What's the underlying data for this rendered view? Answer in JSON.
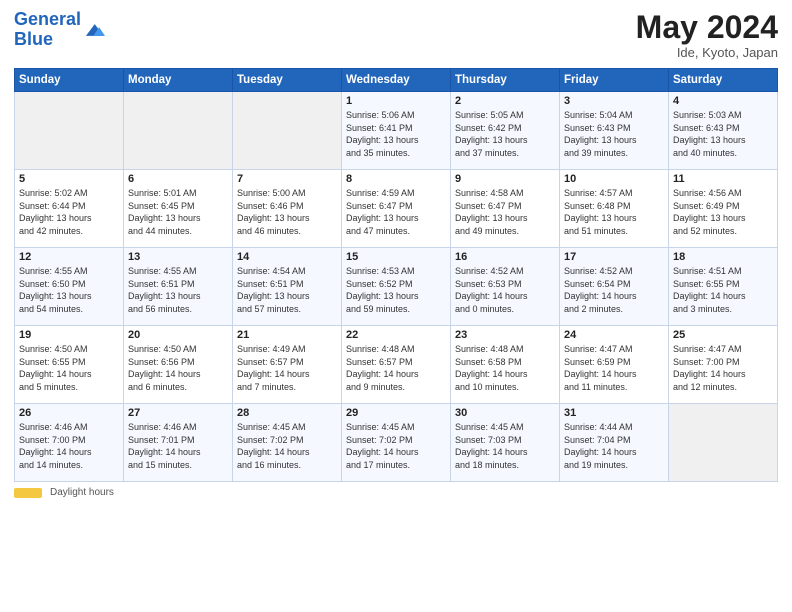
{
  "header": {
    "logo_line1": "General",
    "logo_line2": "Blue",
    "month": "May 2024",
    "location": "Ide, Kyoto, Japan"
  },
  "days_of_week": [
    "Sunday",
    "Monday",
    "Tuesday",
    "Wednesday",
    "Thursday",
    "Friday",
    "Saturday"
  ],
  "footer": {
    "daylight_label": "Daylight hours"
  },
  "weeks": [
    [
      {
        "day": "",
        "info": ""
      },
      {
        "day": "",
        "info": ""
      },
      {
        "day": "",
        "info": ""
      },
      {
        "day": "1",
        "info": "Sunrise: 5:06 AM\nSunset: 6:41 PM\nDaylight: 13 hours\nand 35 minutes."
      },
      {
        "day": "2",
        "info": "Sunrise: 5:05 AM\nSunset: 6:42 PM\nDaylight: 13 hours\nand 37 minutes."
      },
      {
        "day": "3",
        "info": "Sunrise: 5:04 AM\nSunset: 6:43 PM\nDaylight: 13 hours\nand 39 minutes."
      },
      {
        "day": "4",
        "info": "Sunrise: 5:03 AM\nSunset: 6:43 PM\nDaylight: 13 hours\nand 40 minutes."
      }
    ],
    [
      {
        "day": "5",
        "info": "Sunrise: 5:02 AM\nSunset: 6:44 PM\nDaylight: 13 hours\nand 42 minutes."
      },
      {
        "day": "6",
        "info": "Sunrise: 5:01 AM\nSunset: 6:45 PM\nDaylight: 13 hours\nand 44 minutes."
      },
      {
        "day": "7",
        "info": "Sunrise: 5:00 AM\nSunset: 6:46 PM\nDaylight: 13 hours\nand 46 minutes."
      },
      {
        "day": "8",
        "info": "Sunrise: 4:59 AM\nSunset: 6:47 PM\nDaylight: 13 hours\nand 47 minutes."
      },
      {
        "day": "9",
        "info": "Sunrise: 4:58 AM\nSunset: 6:47 PM\nDaylight: 13 hours\nand 49 minutes."
      },
      {
        "day": "10",
        "info": "Sunrise: 4:57 AM\nSunset: 6:48 PM\nDaylight: 13 hours\nand 51 minutes."
      },
      {
        "day": "11",
        "info": "Sunrise: 4:56 AM\nSunset: 6:49 PM\nDaylight: 13 hours\nand 52 minutes."
      }
    ],
    [
      {
        "day": "12",
        "info": "Sunrise: 4:55 AM\nSunset: 6:50 PM\nDaylight: 13 hours\nand 54 minutes."
      },
      {
        "day": "13",
        "info": "Sunrise: 4:55 AM\nSunset: 6:51 PM\nDaylight: 13 hours\nand 56 minutes."
      },
      {
        "day": "14",
        "info": "Sunrise: 4:54 AM\nSunset: 6:51 PM\nDaylight: 13 hours\nand 57 minutes."
      },
      {
        "day": "15",
        "info": "Sunrise: 4:53 AM\nSunset: 6:52 PM\nDaylight: 13 hours\nand 59 minutes."
      },
      {
        "day": "16",
        "info": "Sunrise: 4:52 AM\nSunset: 6:53 PM\nDaylight: 14 hours\nand 0 minutes."
      },
      {
        "day": "17",
        "info": "Sunrise: 4:52 AM\nSunset: 6:54 PM\nDaylight: 14 hours\nand 2 minutes."
      },
      {
        "day": "18",
        "info": "Sunrise: 4:51 AM\nSunset: 6:55 PM\nDaylight: 14 hours\nand 3 minutes."
      }
    ],
    [
      {
        "day": "19",
        "info": "Sunrise: 4:50 AM\nSunset: 6:55 PM\nDaylight: 14 hours\nand 5 minutes."
      },
      {
        "day": "20",
        "info": "Sunrise: 4:50 AM\nSunset: 6:56 PM\nDaylight: 14 hours\nand 6 minutes."
      },
      {
        "day": "21",
        "info": "Sunrise: 4:49 AM\nSunset: 6:57 PM\nDaylight: 14 hours\nand 7 minutes."
      },
      {
        "day": "22",
        "info": "Sunrise: 4:48 AM\nSunset: 6:57 PM\nDaylight: 14 hours\nand 9 minutes."
      },
      {
        "day": "23",
        "info": "Sunrise: 4:48 AM\nSunset: 6:58 PM\nDaylight: 14 hours\nand 10 minutes."
      },
      {
        "day": "24",
        "info": "Sunrise: 4:47 AM\nSunset: 6:59 PM\nDaylight: 14 hours\nand 11 minutes."
      },
      {
        "day": "25",
        "info": "Sunrise: 4:47 AM\nSunset: 7:00 PM\nDaylight: 14 hours\nand 12 minutes."
      }
    ],
    [
      {
        "day": "26",
        "info": "Sunrise: 4:46 AM\nSunset: 7:00 PM\nDaylight: 14 hours\nand 14 minutes."
      },
      {
        "day": "27",
        "info": "Sunrise: 4:46 AM\nSunset: 7:01 PM\nDaylight: 14 hours\nand 15 minutes."
      },
      {
        "day": "28",
        "info": "Sunrise: 4:45 AM\nSunset: 7:02 PM\nDaylight: 14 hours\nand 16 minutes."
      },
      {
        "day": "29",
        "info": "Sunrise: 4:45 AM\nSunset: 7:02 PM\nDaylight: 14 hours\nand 17 minutes."
      },
      {
        "day": "30",
        "info": "Sunrise: 4:45 AM\nSunset: 7:03 PM\nDaylight: 14 hours\nand 18 minutes."
      },
      {
        "day": "31",
        "info": "Sunrise: 4:44 AM\nSunset: 7:04 PM\nDaylight: 14 hours\nand 19 minutes."
      },
      {
        "day": "",
        "info": ""
      }
    ]
  ]
}
